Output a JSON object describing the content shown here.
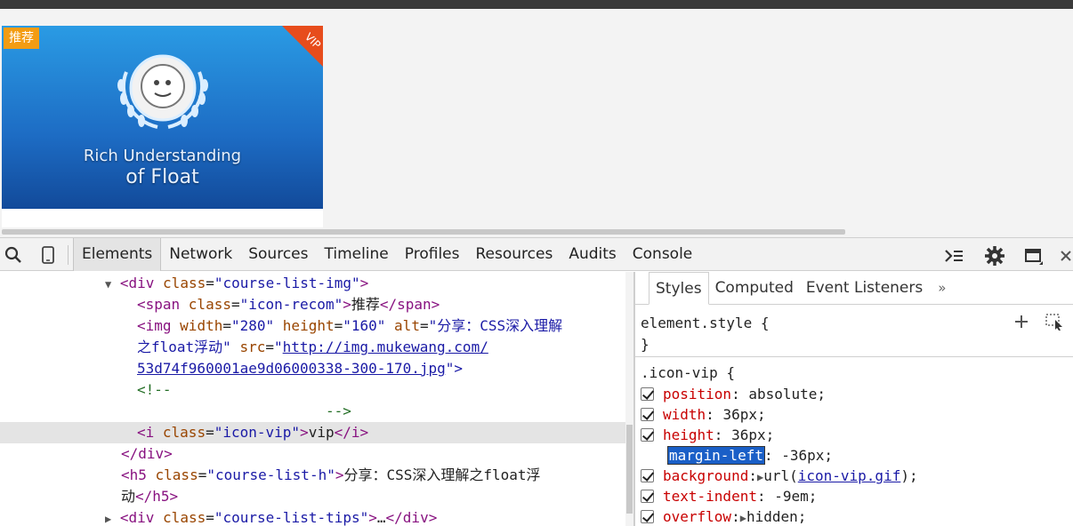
{
  "thumbnail": {
    "badge": "推荐",
    "vip_label": "VIP",
    "title_line1": "Rich Understanding",
    "title_line2": "of Float"
  },
  "devtools": {
    "tabs": [
      "Elements",
      "Network",
      "Sources",
      "Timeline",
      "Profiles",
      "Resources",
      "Audits",
      "Console"
    ],
    "active_tab": "Elements"
  },
  "elements_panel": {
    "l1": {
      "tri": "▼",
      "open": "<div ",
      "attr": "class",
      "eq": "=",
      "val": "\"course-list-img\"",
      "close": ">"
    },
    "l2": {
      "open": "<span ",
      "attr": "class",
      "eq": "=",
      "val": "\"icon-recom\"",
      "close": ">",
      "text": "推荐",
      "end": "</span>"
    },
    "l3": {
      "open": "<img ",
      "a1": "width",
      "v1": "\"280\"",
      "a2": "height",
      "v2": "\"160\"",
      "a3": "alt",
      "v3": "\"分享：CSS深入理解"
    },
    "l4": {
      "v3b": "之float浮动\"",
      "a4": "src",
      "v4q": "\"",
      "link1": "http://img.mukewang.com/"
    },
    "l5": {
      "link2": "53d74f960001ae9d06000338-300-170.jpg",
      "tail": "\">"
    },
    "l6": {
      "comment": "<!--"
    },
    "l7": {
      "comment": "-->"
    },
    "l8": {
      "open": "<i ",
      "attr": "class",
      "eq": "=",
      "val": "\"icon-vip\"",
      "close": ">",
      "text": "vip",
      "end": "</i>"
    },
    "l9": {
      "end": "</div>"
    },
    "l10": {
      "open": "<h5 ",
      "attr": "class",
      "eq": "=",
      "val": "\"course-list-h\"",
      "close": ">",
      "text": "分享：CSS深入理解之float浮"
    },
    "l11": {
      "text": "动",
      "end": "</h5>"
    },
    "l12": {
      "tri": "▶",
      "open": "<div ",
      "attr": "class",
      "eq": "=",
      "val": "\"course-list-tips\"",
      "close": ">",
      "text": "…",
      "end": "</div>"
    }
  },
  "styles_panel": {
    "subtabs": [
      "Styles",
      "Computed",
      "Event Listeners"
    ],
    "more": "»",
    "element_style_open": "element.style {",
    "element_style_close": "}",
    "rule_selector": ".icon-vip {",
    "properties": [
      {
        "name": "position",
        "value": " absolute;",
        "checked": true
      },
      {
        "name": "width",
        "value": " 36px;",
        "checked": true
      },
      {
        "name": "height",
        "value": " 36px;",
        "checked": true
      },
      {
        "name": "margin-left",
        "value": " -36px;",
        "checked": false,
        "highlighted": true
      },
      {
        "name": "background",
        "value_pre": "url(",
        "value_link": "icon-vip.gif",
        "value_post": ");",
        "arrow": "▶",
        "checked": true
      },
      {
        "name": "text-indent",
        "value": " -9em;",
        "checked": true
      },
      {
        "name": "overflow",
        "value": "hidden;",
        "arrow": "▶",
        "checked": true
      }
    ]
  }
}
